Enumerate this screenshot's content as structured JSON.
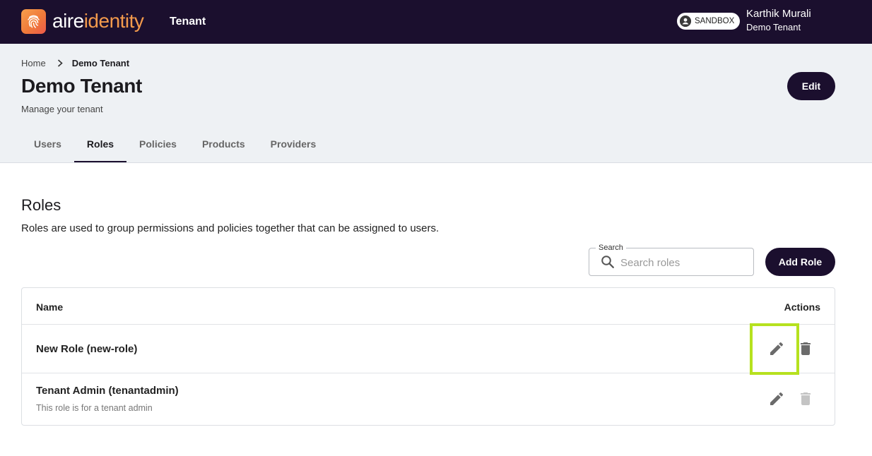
{
  "topbar": {
    "brand_part1": "aire",
    "brand_part2": "identity",
    "app_name": "Tenant",
    "environment_label": "SANDBOX",
    "user_name": "Karthik Murali",
    "user_tenant": "Demo Tenant",
    "icons": {
      "logo": "fingerprint-icon",
      "environment": "account-circle-icon"
    }
  },
  "breadcrumb": {
    "home": "Home",
    "separator": "›",
    "current": "Demo Tenant"
  },
  "page": {
    "title": "Demo Tenant",
    "subtitle": "Manage your tenant",
    "edit_label": "Edit"
  },
  "tabs": [
    {
      "label": "Users",
      "active": false
    },
    {
      "label": "Roles",
      "active": true
    },
    {
      "label": "Policies",
      "active": false
    },
    {
      "label": "Products",
      "active": false
    },
    {
      "label": "Providers",
      "active": false
    }
  ],
  "roles": {
    "title": "Roles",
    "description": "Roles are used to group permissions and policies together that can be assigned to users.",
    "search": {
      "label": "Search",
      "placeholder": "Search roles",
      "value": ""
    },
    "add_label": "Add Role",
    "table": {
      "columns": {
        "name": "Name",
        "actions": "Actions"
      },
      "rows": [
        {
          "name": "New Role (new-role)",
          "description": "",
          "edit_enabled": true,
          "delete_enabled": true
        },
        {
          "name": "Tenant Admin (tenantadmin)",
          "description": "This role is for a tenant admin",
          "edit_enabled": true,
          "delete_enabled": false
        }
      ]
    }
  },
  "colors": {
    "topbar_bg": "#1b0f2e",
    "brand_accent": "#f39a4c",
    "header_bg": "#eef1f4",
    "primary_button": "#1b0f2e",
    "highlight": "#b6e11f"
  }
}
